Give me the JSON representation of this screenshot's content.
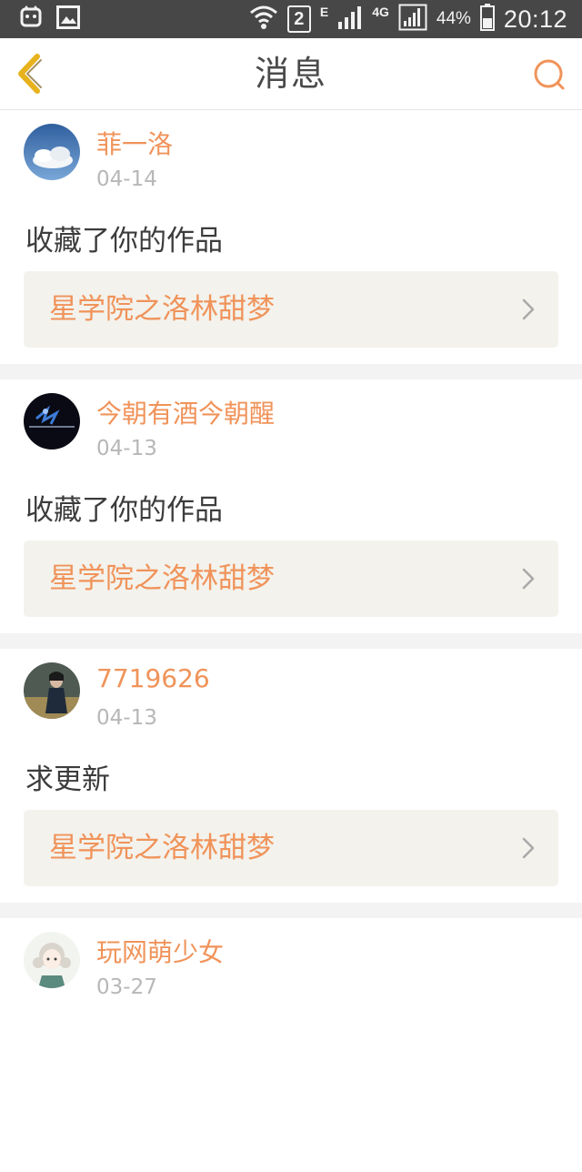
{
  "status_bar": {
    "sim_badge": "2",
    "net_e": "E",
    "net_4g": "4G",
    "battery": "44%",
    "time": "20:12",
    "icons": [
      "cat-icon",
      "image-icon",
      "wifi-icon",
      "signal-icon",
      "battery-icon"
    ]
  },
  "header": {
    "title": "消息",
    "back_icon": "chevron-left-icon",
    "search_icon": "search-icon"
  },
  "colors": {
    "accent": "#f0935a",
    "text_dark": "#3c3c3c",
    "text_muted": "#b7b7b7",
    "card_link_bg": "#f3f2ec",
    "separator_bg": "#f3f3f3",
    "status_bar_bg": "#474747"
  },
  "messages": [
    {
      "username": "菲一洛",
      "date": "04-14",
      "action": "收藏了你的作品",
      "work_title": "星学院之洛林甜梦"
    },
    {
      "username": "今朝有酒今朝醒",
      "date": "04-13",
      "action": "收藏了你的作品",
      "work_title": "星学院之洛林甜梦"
    },
    {
      "username": "7719626",
      "date": "04-13",
      "action": "求更新",
      "work_title": "星学院之洛林甜梦"
    },
    {
      "username": "玩网萌少女",
      "date": "03-27"
    }
  ]
}
